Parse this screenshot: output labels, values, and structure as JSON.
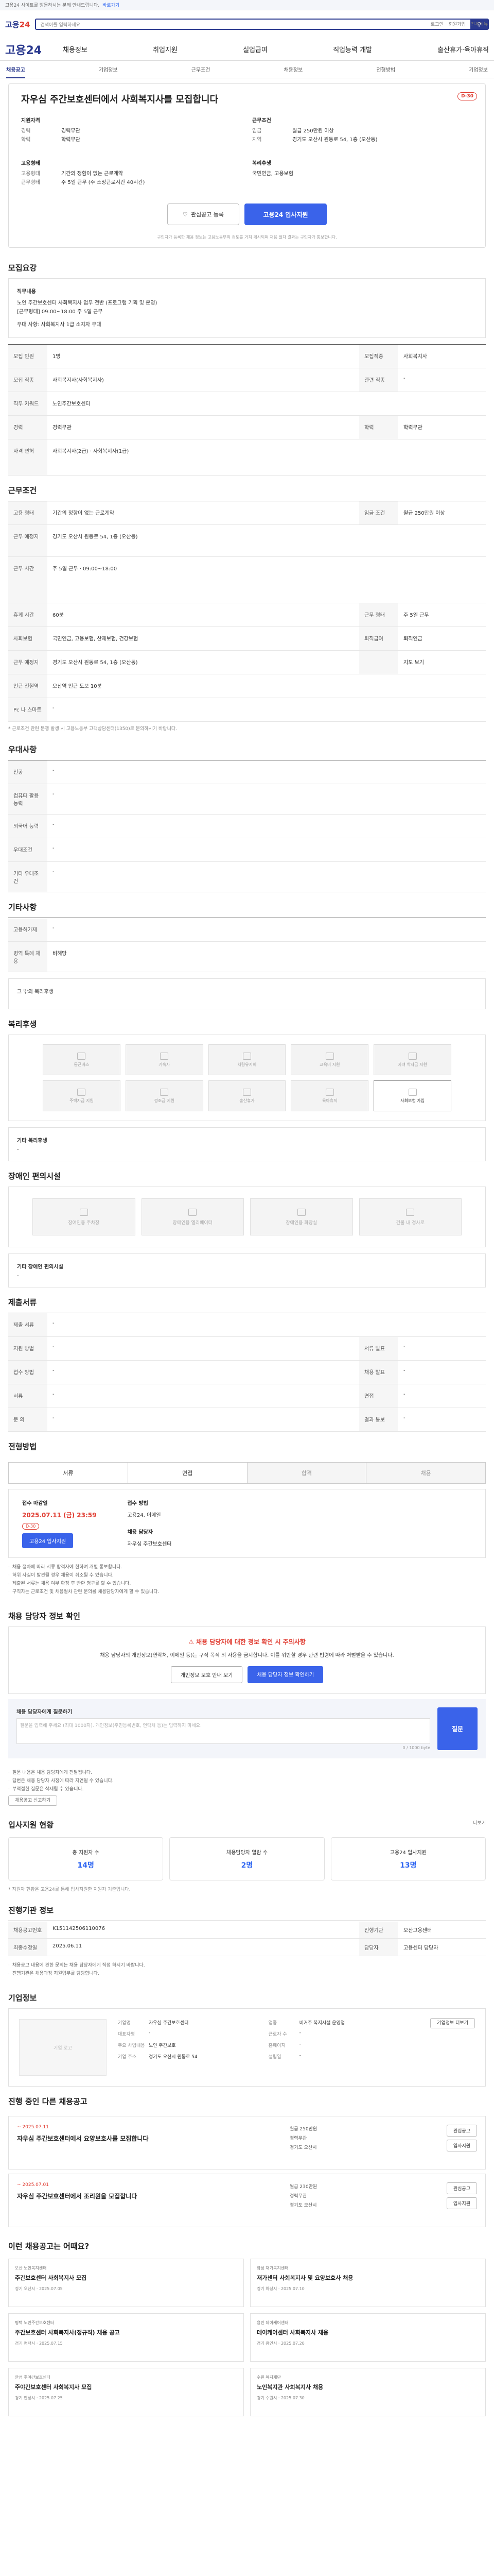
{
  "notice": {
    "text": "고용24 사이트를 방문하시는 분께 안내드립니다.",
    "link": "바로가기"
  },
  "brand": {
    "logo_a": "고용",
    "logo_b": "24"
  },
  "search": {
    "placeholder": "검색어를 입력하세요"
  },
  "util": [
    "로그인",
    "회원가입",
    "전체메뉴"
  ],
  "menu": {
    "home": "고용24",
    "items": [
      "채용정보",
      "취업지원",
      "실업급여",
      "직업능력 개발",
      "출산휴가·육아휴직"
    ]
  },
  "tabs": [
    "채용공고",
    "기업정보",
    "근무조건",
    "채용정보",
    "전형방법",
    "기업정보"
  ],
  "job": {
    "title": "자우심 주간보호센터에서 사회복지사를 모집합니다",
    "badge": "D-30",
    "left_head": "지원자격",
    "left": [
      {
        "k": "경력",
        "v": "경력무관"
      },
      {
        "k": "학력",
        "v": "학력무관"
      }
    ],
    "left_head2": "고용형태",
    "left2": [
      {
        "k": "고용형태",
        "v": "기간의 정함이 없는 근로계약"
      },
      {
        "k": "근무형태",
        "v": "주 5일 근무 (주 소정근로시간 40시간)"
      }
    ],
    "right_head": "근무조건",
    "right": [
      {
        "k": "임금",
        "v": "월급 250만원 이상"
      },
      {
        "k": "지역",
        "v": "경기도 오산시 원동로 54, 1층 (오산동)"
      }
    ],
    "right_head2": "복리후생",
    "right2": [
      {
        "k": "",
        "v": "국민연금, 고용보험"
      }
    ],
    "btn_save": "관심공고 등록",
    "btn_apply": "고용24 입사지원",
    "disclaimer": "구인자가 등록한 채용 정보는 고용노동부의 검토를 거쳐 게시되며 채용 절차 결과는 구인자가 통보합니다."
  },
  "recruit": {
    "title": "모집요강",
    "detail_head": "직무내용",
    "detail": [
      "노인 주간보호센터 사회복지사 업무 전반 (프로그램 기획 및 운영)",
      "[근무형태] 09:00~18:00 주 5일 근무",
      "우대 사항: 사회복지사 1급 소지자 우대"
    ],
    "rows": [
      {
        "k": "모집 인원",
        "v": "1명",
        "k2": "모집직종",
        "v2": "사회복지사"
      },
      {
        "k": "모집 직종",
        "v": "사회복지사(사회복지사)",
        "k2": "관련 직종",
        "v2": "-"
      },
      {
        "k": "직무 키워드",
        "v": "노인주간보호센터"
      },
      {
        "k": "경력",
        "v": "경력무관",
        "k2": "학력",
        "v2": "학력무관"
      },
      {
        "k": "자격 면허",
        "v": "사회복지사(2급) · 사회복지사(1급)"
      }
    ]
  },
  "work": {
    "title": "근무조건",
    "rows": [
      {
        "k": "고용 형태",
        "v": "기간의 정함이 없는 근로계약",
        "k2": "임금 조건",
        "v2": "월급 250만원 이상"
      },
      {
        "k": "근무 예정지",
        "v": "경기도 오산시 원동로 54, 1층 (오산동)"
      },
      {
        "k": "근무 시간",
        "v": "주 5일 근무 · 09:00~18:00"
      },
      {
        "k": "휴게 시간",
        "v": "60분",
        "k2": "근무 형태",
        "v2": "주 5일 근무"
      },
      {
        "k": "사회보험",
        "v": "국민연금, 고용보험, 산재보험, 건강보험",
        "k2": "퇴직급여",
        "v2": "퇴직연금"
      },
      {
        "k": "근무 예정지",
        "v": "경기도 오산시 원동로 54, 1층 (오산동)",
        "k2": "",
        "v2": "지도 보기"
      },
      {
        "k": "인근 전철역",
        "v": "오산역 인근 도보 10분"
      },
      {
        "k": "Pc 나 스마트",
        "v": "-"
      }
    ],
    "note": "* 근로조건 관련 분쟁 발생 시 고용노동부 고객상담센터(1350)로 문의하시기 바랍니다."
  },
  "prefer": {
    "title": "우대사항",
    "rows": [
      {
        "k": "전공",
        "v": "-"
      },
      {
        "k": "컴퓨터 활용 능력",
        "v": "-"
      },
      {
        "k": "외국어 능력",
        "v": "-"
      },
      {
        "k": "우대조건",
        "v": "-"
      },
      {
        "k": "기타 우대조건",
        "v": "-"
      }
    ]
  },
  "etc": {
    "title": "기타사항",
    "rows": [
      {
        "k": "고용허가제",
        "v": "-"
      },
      {
        "k": "병역 특례 채용",
        "v": "비해당"
      }
    ],
    "more": "그 밖의 복리후생"
  },
  "welfare": {
    "title": "복리후생",
    "tiles": [
      "통근버스",
      "기숙사",
      "차량유지비",
      "교육비 지원",
      "자녀 학자금 지원",
      "주택자금 지원",
      "경조금 지원",
      "출산휴가",
      "육아휴직",
      "사회보험 가입"
    ],
    "sub": "기타 복리후생",
    "sub_v": "-"
  },
  "disabled": {
    "title": "장애인 편의시설",
    "tiles": [
      "장애인용 주차장",
      "장애인용 엘리베이터",
      "장애인용 화장실",
      "건물 내 경사로"
    ],
    "sub": "기타 장애인 편의시설",
    "sub_v": "-"
  },
  "docs": {
    "title": "제출서류",
    "rows": [
      {
        "k": "제출 서류",
        "v": "-"
      },
      {
        "k": "지원 방법",
        "v": "-",
        "k2": "서류 발표",
        "v2": "-"
      },
      {
        "k": "접수 방법",
        "v": "-",
        "k2": "채용 발표",
        "v2": "-"
      },
      {
        "k": "서류",
        "v": "-",
        "k2": "면접",
        "v2": "-"
      },
      {
        "k": "문 의",
        "v": "-",
        "k2": "결과 통보",
        "v2": "-"
      }
    ]
  },
  "process": {
    "title": "전형방법",
    "steps": [
      "서류",
      "면접",
      "합격",
      "채용"
    ],
    "due_label": "접수 마감일",
    "due": "2025.07.11 (금) 23:59",
    "due_badge": "D-30",
    "m_label": "접수 방법",
    "m_value": "고용24, 이메일",
    "contact_label": "채용 담당자",
    "contact": "자우심 주간보호센터",
    "apply_btn": "고용24 입사지원",
    "notes": [
      "채용 절차에 따라 서류 합격자에 한하여 개별 통보합니다.",
      "허위 사실이 발견될 경우 채용이 취소될 수 있습니다.",
      "제출된 서류는 채용 여부 확정 후 반환 청구를 할 수 있습니다.",
      "구직자는 근로조건 및 채용절차 관련 문의를 채용담당자에게 할 수 있습니다."
    ]
  },
  "warn": {
    "title": "채용 담당자 정보 확인",
    "head": "채용 담당자에 대한 정보 확인 시 주의사항",
    "text": "채용 담당자의 개인정보(연락처, 이메일 등)는 구직 목적 외 사용을 금지합니다. 이를 위반할 경우 관련 법령에 따라 처벌받을 수 있습니다.",
    "b1": "개인정보 보호 안내 보기",
    "b2": "채용 담당자 정보 확인하기"
  },
  "question": {
    "label": "채용 담당자에게 질문하기",
    "placeholder": "질문을 입력해 주세요 (최대 1000자). 개인정보(주민등록번호, 연락처 등)는 입력하지 마세요.",
    "count": "0 / 1000 byte",
    "btn": "질문",
    "notes": [
      "질문 내용은 채용 담당자에게 전달됩니다.",
      "답변은 채용 담당자 사정에 따라 지연될 수 있습니다.",
      "부적절한 질문은 삭제될 수 있습니다."
    ],
    "report": "채용공고 신고하기"
  },
  "applicants": {
    "title": "입사지원 현황",
    "more": "더보기",
    "stats": [
      {
        "label": "총 지원자 수",
        "value": "14명"
      },
      {
        "label": "채용담당자 열람 수",
        "value": "2명"
      },
      {
        "label": "고용24 입사지원",
        "value": "13명"
      }
    ],
    "note": "* 지원자 현황은 고용24를 통해 입사지원한 지원자 기준입니다."
  },
  "history": {
    "title": "진행기관 정보",
    "rows": [
      {
        "k": "채용공고번호",
        "v": "K151142506110076",
        "k2": "진행기관",
        "v2": "오산고용센터"
      },
      {
        "k": "최종수정일",
        "v": "2025.06.11",
        "k2": "담당자",
        "v2": "고용센터 담당자"
      }
    ],
    "notes": [
      "채용공고 내용에 관한 문의는 채용 담당자에게 직접 하시기 바랍니다.",
      "진행기관은 채용과정 지원업무를 담당합니다."
    ]
  },
  "company": {
    "title": "기업정보",
    "img": "기업 로고",
    "fields": [
      {
        "k": "기업명",
        "v": "자우심 주간보호센터"
      },
      {
        "k": "업종",
        "v": "비거주 복지시설 운영업"
      },
      {
        "k": "대표자명",
        "v": "-"
      },
      {
        "k": "근로자 수",
        "v": "-"
      },
      {
        "k": "주요 사업내용",
        "v": "노인 주간보호"
      },
      {
        "k": "홈페이지",
        "v": "-"
      },
      {
        "k": "기업 주소",
        "v": "경기도 오산시 원동로 54"
      },
      {
        "k": "설립일",
        "v": "-"
      }
    ],
    "btn": "기업정보 더보기"
  },
  "ongoing": {
    "title": "진행 중인 다른 채용공고",
    "items": [
      {
        "date": "~ 2025.07.11",
        "title": "자우심 주간보호센터에서 요양보호사를 모집합니다",
        "meta": [
          "월급 250만원",
          "경력무관",
          "경기도 오산시"
        ],
        "btns": [
          "관심공고",
          "입사지원"
        ]
      },
      {
        "date": "~ 2025.07.01",
        "title": "자우심 주간보호센터에서 조리원을 모집합니다",
        "meta": [
          "월급 230만원",
          "경력무관",
          "경기도 오산시"
        ],
        "btns": [
          "관심공고",
          "입사지원"
        ]
      }
    ]
  },
  "recommend": {
    "title": "이런 채용공고는 어때요?",
    "items": [
      {
        "co": "오산 노인복지센터",
        "title": "주간보호센터 사회복지사 모집",
        "meta": "경기 오산시 · 2025.07.05"
      },
      {
        "co": "화성 재가복지센터",
        "title": "재가센터 사회복지사 및 요양보호사 채용",
        "meta": "경기 화성시 · 2025.07.10"
      },
      {
        "co": "평택 노인주간보호센터",
        "title": "주간보호센터 사회복지사(정규직) 채용 공고",
        "meta": "경기 평택시 · 2025.07.15"
      },
      {
        "co": "용인 데이케어센터",
        "title": "데이케어센터 사회복지사 채용",
        "meta": "경기 용인시 · 2025.07.20"
      },
      {
        "co": "안성 주야간보호센터",
        "title": "주야간보호센터 사회복지사 모집",
        "meta": "경기 안성시 · 2025.07.25"
      },
      {
        "co": "수원 복지재단",
        "title": "노인복지관 사회복지사 채용",
        "meta": "경기 수원시 · 2025.07.30"
      }
    ]
  }
}
